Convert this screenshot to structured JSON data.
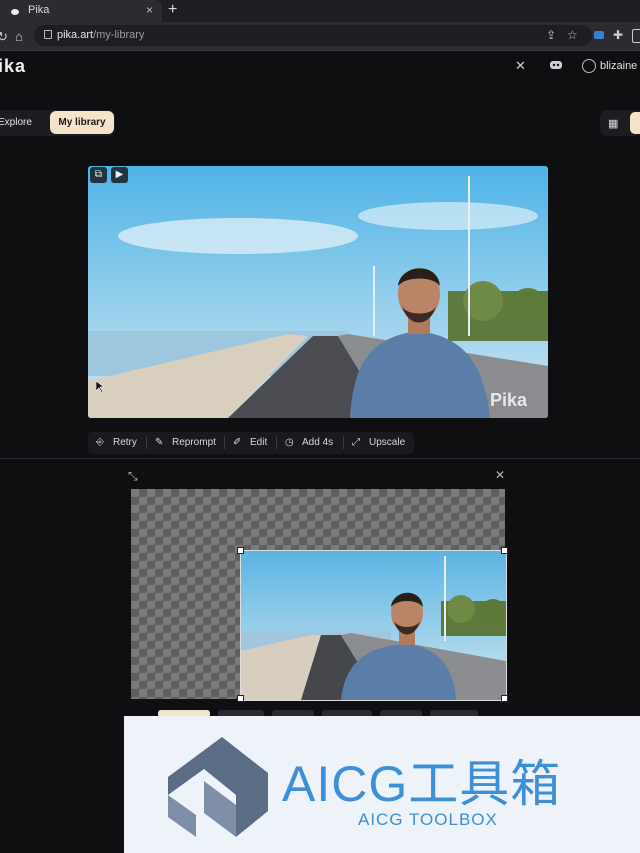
{
  "browser": {
    "tab_title": "Pika",
    "new_tab": "+",
    "tab_close": "×",
    "url_host": "pika.art",
    "url_path": "/my-library"
  },
  "header": {
    "logo": "ika",
    "username": "blizaine"
  },
  "tabs": {
    "explore": "Explore",
    "library": "My library"
  },
  "video": {
    "watermark": "Pika"
  },
  "toolbar": {
    "retry": "Retry",
    "reprompt": "Reprompt",
    "edit": "Edit",
    "add": "Add 4s",
    "upscale": "Upscale"
  },
  "banner": {
    "title": "AICG工具箱",
    "subtitle": "AICG TOOLBOX"
  },
  "colors": {
    "accent": "#f4e4c9",
    "banner_text": "#3f8fd6",
    "background": "#0f0f11"
  }
}
